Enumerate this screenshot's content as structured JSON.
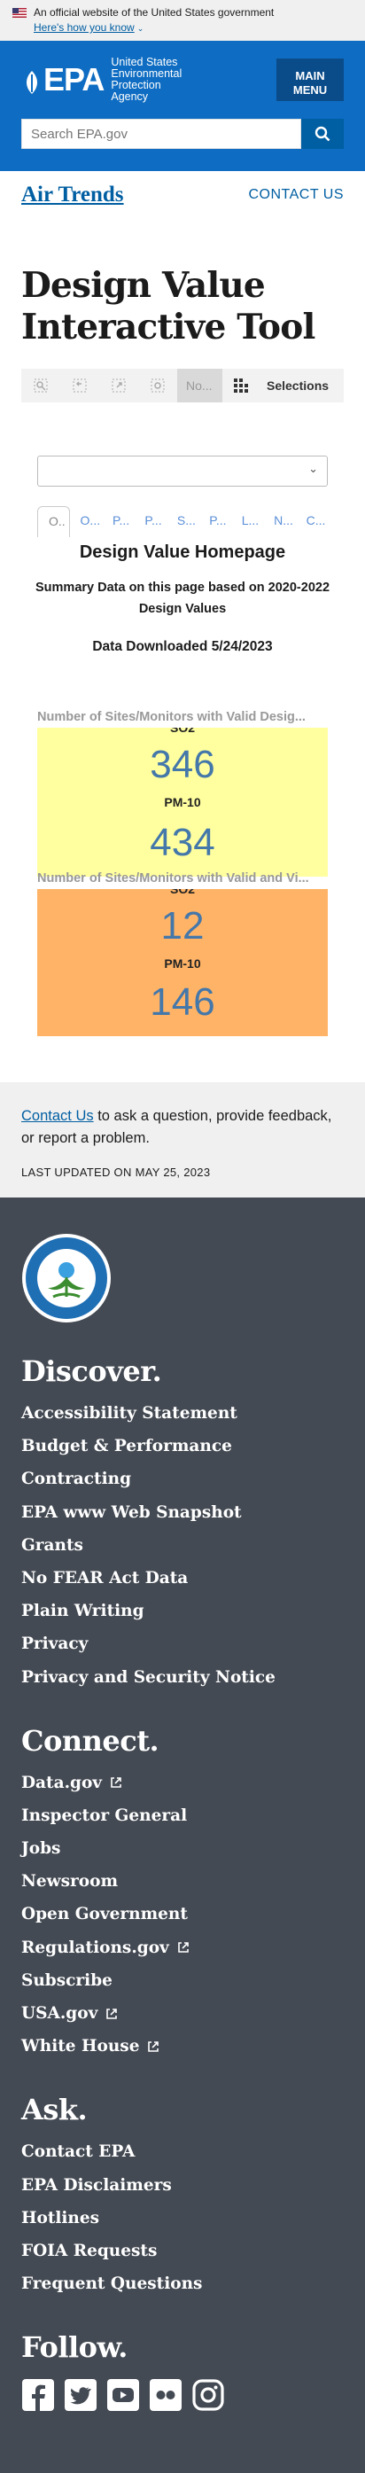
{
  "gov_banner": {
    "official_text": "An official website of the United States government",
    "how_link": "Here's how you know"
  },
  "header": {
    "logo_mark": "EPA",
    "logo_text_1": "United States",
    "logo_text_2": "Environmental Protection",
    "logo_text_3": "Agency",
    "menu_line1": "MAIN",
    "menu_line2": "MENU",
    "search_placeholder": "Search EPA.gov"
  },
  "subnav": {
    "title": "Air Trends",
    "contact": "CONTACT US"
  },
  "page_title": "Design Value Interactive Tool",
  "toolbar": {
    "bookmark_label": "No...",
    "selections_label": "Selections"
  },
  "qlik": {
    "tabs": [
      "O..",
      "O...",
      "P...",
      "P...",
      "S...",
      "P...",
      "L...",
      "N...",
      "C..."
    ],
    "sheet_title": "Design Value Homepage",
    "summary": "Summary Data on this page based on 2020-2022 Design Values",
    "downloaded": "Data Downloaded 5/24/2023",
    "kpi1": {
      "header": "Number of Sites/Monitors with Valid Desig...",
      "color": "#ffff9f",
      "label_a": "SO2",
      "value_a": "346",
      "label_b": "PM-10",
      "value_b": "434"
    },
    "kpi2": {
      "header": "Number of Sites/Monitors with Valid and Vi...",
      "color": "#ffb366",
      "label_a": "SO2",
      "value_a": "12",
      "label_b": "PM-10",
      "value_b": "146"
    }
  },
  "contact_strip": {
    "link": "Contact Us",
    "text": " to ask a question, provide feedback, or report a problem.",
    "updated": "LAST UPDATED ON MAY 25, 2023"
  },
  "footer": {
    "discover": {
      "heading": "Discover.",
      "items": [
        "Accessibility Statement",
        "Budget & Performance",
        "Contracting",
        "EPA www Web Snapshot",
        "Grants",
        "No FEAR Act Data",
        "Plain Writing",
        "Privacy",
        "Privacy and Security Notice"
      ]
    },
    "connect": {
      "heading": "Connect.",
      "items": [
        "Data.gov",
        "Inspector General",
        "Jobs",
        "Newsroom",
        "Open Government",
        "Regulations.gov",
        "Subscribe",
        "USA.gov",
        "White House"
      ]
    },
    "ask": {
      "heading": "Ask.",
      "items": [
        "Contact EPA",
        "EPA Disclaimers",
        "Hotlines",
        "FOIA Requests",
        "Frequent Questions"
      ]
    },
    "follow": {
      "heading": "Follow.",
      "icons": [
        "facebook-icon",
        "twitter-icon",
        "youtube-icon",
        "flickr-icon",
        "instagram-icon"
      ]
    }
  },
  "colors": {
    "header_blue": "#0e6cc2",
    "link_blue": "#005ea2",
    "footer_bg": "#444a53"
  }
}
